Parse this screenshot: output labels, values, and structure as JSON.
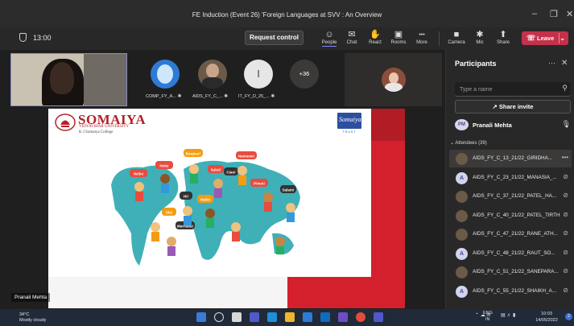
{
  "window": {
    "title": "FE Induction (Event 26) 'Foreign Languages at SVV : An Overview",
    "minimize": "–",
    "maximize": "❐",
    "close": "✕"
  },
  "toolbar": {
    "timer": "13:00",
    "request_control": "Request control",
    "items": [
      {
        "label": "People",
        "icon": "people-icon",
        "glyph": "☺"
      },
      {
        "label": "Chat",
        "icon": "chat-icon",
        "glyph": "✉"
      },
      {
        "label": "React",
        "icon": "hand-icon",
        "glyph": "✋"
      },
      {
        "label": "Rooms",
        "icon": "rooms-icon",
        "glyph": "▣"
      },
      {
        "label": "More",
        "icon": "more-icon",
        "glyph": "•••"
      },
      {
        "label": "Camera",
        "icon": "camera-off-icon",
        "glyph": "■"
      },
      {
        "label": "Mic",
        "icon": "mic-off-icon",
        "glyph": "✱"
      },
      {
        "label": "Share",
        "icon": "share-icon",
        "glyph": "⬆"
      }
    ],
    "leave": "Leave"
  },
  "participants_strip": [
    {
      "label": "COMP_FY_A...",
      "color": "#2e7bd6"
    },
    {
      "label": "AIDS_FY_C_...",
      "color": "#6b5a48"
    },
    {
      "label": "IT_FY_D_25_...",
      "initial": "I",
      "color": "#e6e6e6"
    }
  ],
  "overflow_count": "+36",
  "slide": {
    "logo_title": "SOMAIYA",
    "logo_sub1": "VIDYAVIHAR UNIVERSITY",
    "logo_sub2": "K J Somaiya College",
    "brand_badge": "Somaiya",
    "brand_badge_sub": "TRUST",
    "bubbles": [
      "Hello!",
      "Hola!",
      "Bonjour!",
      "Salut!",
      "Ciao!",
      "Namaste!",
      "Hi!",
      "Ola!",
      "Hallo!",
      "Privet!",
      "Salam!",
      "Merhaba!"
    ]
  },
  "presenter_tag": "Pranali Mehta",
  "panel": {
    "title": "Participants",
    "search_placeholder": "Type a name",
    "share_invite": "Share invite",
    "presenter": {
      "initials": "PM",
      "name": "Pranali Mehta"
    },
    "attendees_header": "Attendees (39)",
    "attendees": [
      {
        "name": "AIDS_FY_C_13_21/22_GIRIDHA...",
        "initial": "",
        "pic": true,
        "selected": true,
        "action": "•••"
      },
      {
        "name": "AIDS_FY_C_23_21/22_MANASIA_...",
        "initial": "A",
        "pic": false,
        "selected": false,
        "action": "⊘"
      },
      {
        "name": "AIDS_FY_C_37_21/22_PATEL_HA...",
        "initial": "",
        "pic": true,
        "selected": false,
        "action": "⊘"
      },
      {
        "name": "AIDS_FY_C_40_21/22_PATEL_TIRTH",
        "initial": "",
        "pic": true,
        "selected": false,
        "action": "⊘"
      },
      {
        "name": "AIDS_FY_C_47_21/22_RANE_ATH...",
        "initial": "",
        "pic": true,
        "selected": false,
        "action": "⊘"
      },
      {
        "name": "AIDS_FY_C_48_21/22_RAUT_SO...",
        "initial": "A",
        "pic": false,
        "selected": false,
        "action": "⊘"
      },
      {
        "name": "AIDS_FY_C_51_21/22_SANEPARA...",
        "initial": "",
        "pic": true,
        "selected": false,
        "action": "⊘"
      },
      {
        "name": "AIDS_FY_C_55_21/22_SHAIKH_A...",
        "initial": "A",
        "pic": false,
        "selected": false,
        "action": "⊘"
      }
    ]
  },
  "taskbar": {
    "temperature": "34°C",
    "weather": "Mostly cloudy",
    "lang1": "ENG",
    "lang2": "IN",
    "time": "10:03",
    "date": "14/05/2022",
    "notifications": "2"
  },
  "colors": {
    "accent": "#7f85f5",
    "leave": "#c4314b",
    "brand_red": "#b5202a"
  }
}
